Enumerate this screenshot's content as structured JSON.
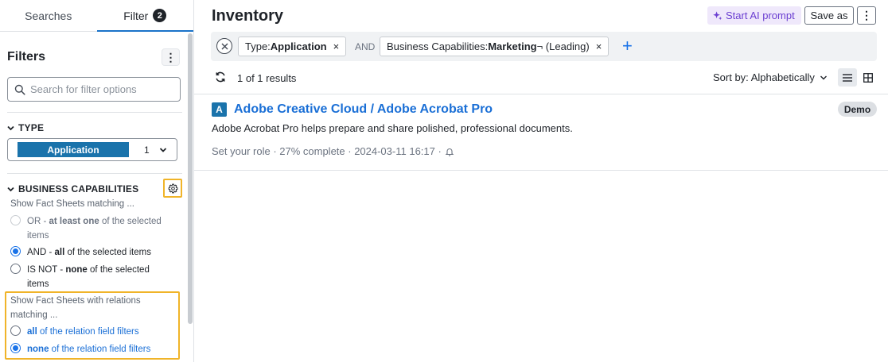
{
  "tabs": [
    {
      "label": "Searches"
    },
    {
      "label": "Filter",
      "count": "2"
    }
  ],
  "filters": {
    "title": "Filters",
    "more": "⋮",
    "search_placeholder": "Search for filter options"
  },
  "type_section": {
    "title": "TYPE",
    "selected": "Application",
    "count": "1"
  },
  "bc_section": {
    "title": "BUSINESS CAPABILITIES",
    "match_hint": "Show Fact Sheets matching ...",
    "options": [
      {
        "pre": "OR - ",
        "bold": "at least one",
        "post": " of the selected items"
      },
      {
        "pre": "AND - ",
        "bold": "all",
        "post": " of the selected items"
      },
      {
        "pre": "IS NOT - ",
        "bold": "none",
        "post": " of the selected items"
      }
    ],
    "relation_hint": "Show Fact Sheets with relations matching ...",
    "relation_options": [
      {
        "bold": "all",
        "post": " of the relation field filters"
      },
      {
        "bold": "none",
        "post": " of the relation field filters"
      }
    ]
  },
  "main": {
    "title": "Inventory",
    "ai_prompt": "Start AI prompt",
    "save_as": "Save as",
    "more": "⋮"
  },
  "filterbar": {
    "chip1_label": "Type: ",
    "chip1_value": "Application",
    "and": "AND",
    "chip2_label": "Business Capabilities: ",
    "chip2_value": "Marketing",
    "chip2_suffix": " ¬ (Leading)",
    "remove": "×",
    "add": "+"
  },
  "results": {
    "count": "1 of 1 results",
    "sort": "Sort by: Alphabetically"
  },
  "factsheet": {
    "badge": "A",
    "title": "Adobe Creative Cloud / Adobe Acrobat Pro",
    "tag": "Demo",
    "description": "Adobe Acrobat Pro helps prepare and share polished, professional documents.",
    "meta": "Set your role · 27% complete · 2024-03-11 16:17 ·"
  },
  "colors": {
    "accent": "#1a73e8",
    "type_application": "#1a73ab",
    "highlight": "#f0b429",
    "ai": "#6b3fd1"
  }
}
